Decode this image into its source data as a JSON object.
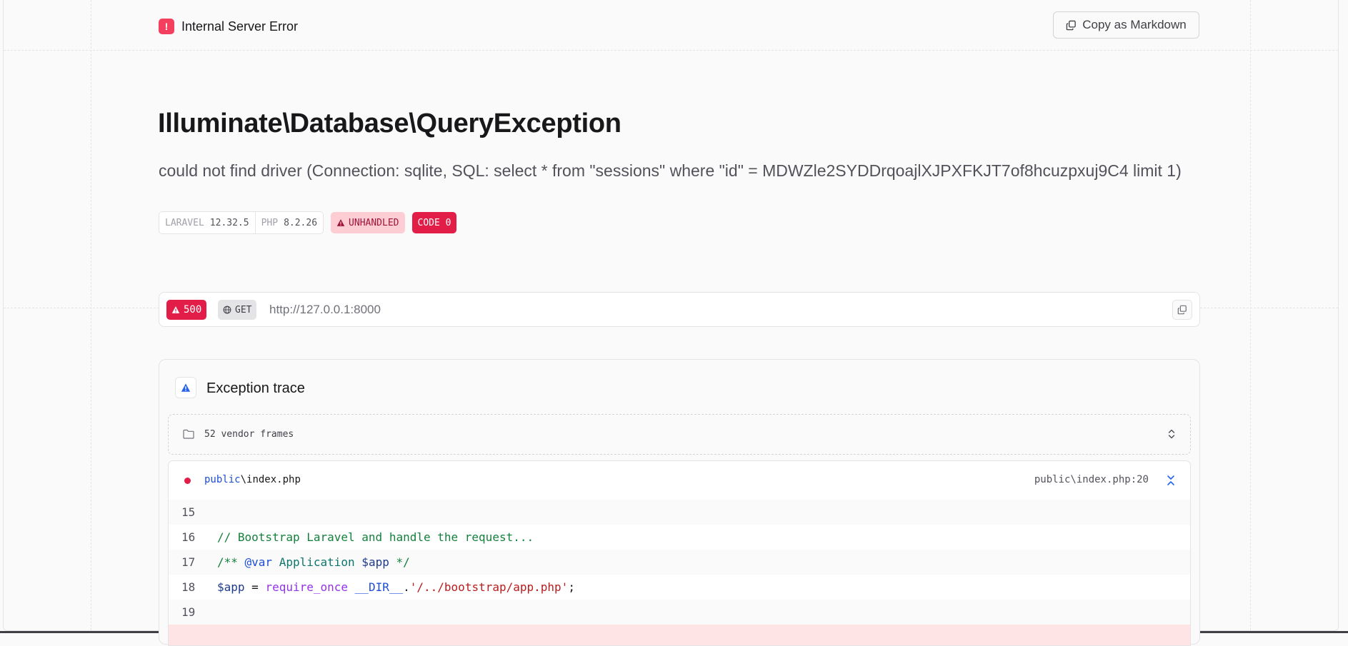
{
  "header": {
    "badge_symbol": "!",
    "title": "Internal Server Error",
    "copy_markdown_label": "Copy as Markdown"
  },
  "exception": {
    "class_name": "Illuminate\\Database\\QueryException",
    "message": "could not find driver (Connection: sqlite, SQL: select * from \"sessions\" where \"id\" = MDWZle2SYDDrqoajlXJPXFKJT7of8hcuzpxuj9C4 limit 1)"
  },
  "badges": {
    "laravel_label": "LARAVEL",
    "laravel_version": "12.32.5",
    "php_label": "PHP",
    "php_version": "8.2.26",
    "unhandled_label": "UNHANDLED",
    "code_label": "CODE 0"
  },
  "request": {
    "status": "500",
    "method": "GET",
    "url": "http://127.0.0.1:8000"
  },
  "trace": {
    "title": "Exception trace",
    "vendor_frames_label": "52 vendor frames",
    "frame": {
      "dir": "public",
      "separator": "\\",
      "file": "index.php",
      "location": "public\\index.php:20"
    },
    "code_lines": [
      {
        "number": "15",
        "tokens": []
      },
      {
        "number": "16",
        "tokens": [
          {
            "t": "// Bootstrap Laravel and handle the request...",
            "c": "c-comment"
          }
        ]
      },
      {
        "number": "17",
        "tokens": [
          {
            "t": "/** ",
            "c": "c-comment"
          },
          {
            "t": "@var",
            "c": "c-doc"
          },
          {
            "t": " ",
            "c": ""
          },
          {
            "t": "Application",
            "c": "c-type"
          },
          {
            "t": " $app",
            "c": "c-var"
          },
          {
            "t": " */",
            "c": "c-comment"
          }
        ]
      },
      {
        "number": "18",
        "tokens": [
          {
            "t": "$app",
            "c": "c-var"
          },
          {
            "t": " = ",
            "c": ""
          },
          {
            "t": "require_once",
            "c": "c-kw"
          },
          {
            "t": " ",
            "c": ""
          },
          {
            "t": "__DIR__",
            "c": "c-const"
          },
          {
            "t": ".",
            "c": ""
          },
          {
            "t": "'/../bootstrap/app.php'",
            "c": "c-str"
          },
          {
            "t": ";",
            "c": ""
          }
        ]
      },
      {
        "number": "19",
        "tokens": []
      },
      {
        "number": "",
        "tokens": [],
        "error": true
      }
    ]
  },
  "colors": {
    "accent": "#e11d48",
    "error_badge": "#f43f5e",
    "unhandled_bg": "#fecdd3",
    "unhandled_text": "#9f1239"
  },
  "icons": {
    "copy": "copy-icon",
    "warning": "warning-triangle-icon",
    "globe": "globe-icon",
    "folder": "folder-icon",
    "chevron_updown": "chevron-up-down-icon",
    "collapse": "chevrons-collapse-icon"
  }
}
